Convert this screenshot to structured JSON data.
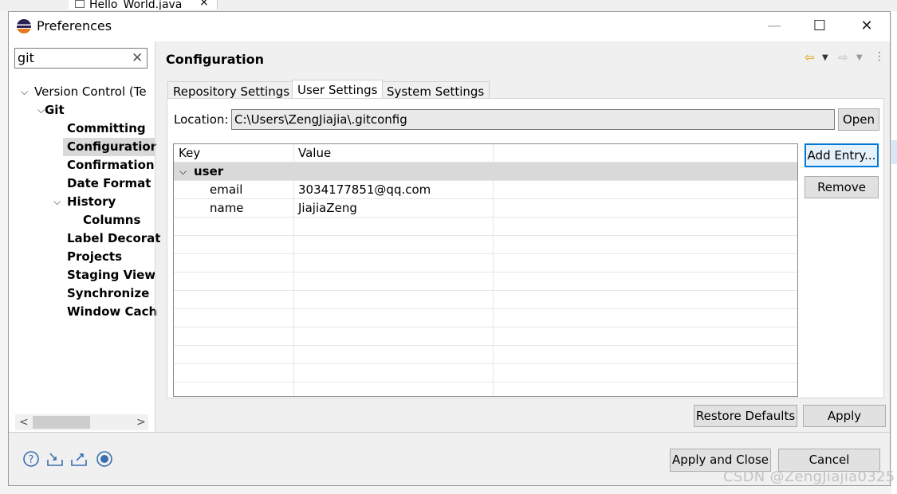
{
  "background": {
    "editor_tab": "Hello_World.java",
    "editor_tab_close": "×"
  },
  "dialog": {
    "title": "Preferences",
    "window_controls": [
      "—",
      "☐",
      "✕"
    ],
    "filter": {
      "value": "git",
      "clear": "✕"
    },
    "tree": [
      {
        "label": "Version Control (Team)",
        "display": "Version Control (Te",
        "level": 0,
        "expanded": true,
        "bold": false
      },
      {
        "label": "Git",
        "level": 1,
        "expanded": true,
        "bold": true
      },
      {
        "label": "Committing",
        "level": 2,
        "bold": true
      },
      {
        "label": "Configuration",
        "display": "Configuratior",
        "level": 2,
        "bold": true,
        "selected": true
      },
      {
        "label": "Confirmations",
        "display": "Confirmation",
        "level": 2,
        "bold": true
      },
      {
        "label": "Date Format",
        "level": 2,
        "bold": true
      },
      {
        "label": "History",
        "level": 2,
        "expanded": true,
        "bold": true
      },
      {
        "label": "Columns",
        "level": 3,
        "bold": true
      },
      {
        "label": "Label Decorations",
        "display": "Label Decorat",
        "level": 2,
        "bold": true
      },
      {
        "label": "Projects",
        "level": 2,
        "bold": true
      },
      {
        "label": "Staging View",
        "level": 2,
        "bold": true
      },
      {
        "label": "Synchronize",
        "level": 2,
        "bold": true
      },
      {
        "label": "Window Cache",
        "display": "Window Cach",
        "level": 2,
        "bold": true
      }
    ],
    "scroll_arrows": [
      "<",
      ">"
    ],
    "page_title": "Configuration",
    "nav_icons": [
      "back-arrow-icon",
      "dropdown-icon",
      "forward-arrow-icon",
      "dropdown-icon",
      "menu-icon"
    ],
    "tabs": [
      {
        "label": "Repository Settings",
        "active": false
      },
      {
        "label": "User Settings",
        "active": true
      },
      {
        "label": "System Settings",
        "active": false
      }
    ],
    "location": {
      "label": "Location:",
      "value": "C:\\Users\\ZengJiajia\\.gitconfig",
      "open_button": "Open"
    },
    "table": {
      "headers": [
        "Key",
        "Value"
      ],
      "rows": [
        {
          "key": "user",
          "value": "",
          "is_section": true,
          "expanded": true
        },
        {
          "key": "email",
          "value": "3034177851@qq.com"
        },
        {
          "key": "name",
          "value": "JiajiaZeng"
        }
      ]
    },
    "side_buttons": {
      "add_entry": "Add Entry...",
      "remove": "Remove"
    },
    "restore_defaults": "Restore Defaults",
    "apply": "Apply",
    "bottom_icons": [
      "help-icon",
      "import-icon",
      "export-icon",
      "record-icon"
    ],
    "apply_and_close": "Apply and Close",
    "cancel": "Cancel"
  },
  "watermark": "CSDN @ZengJiajia0325",
  "colors": {
    "selection": "#d9d9d9",
    "accent": "#0078d7"
  }
}
